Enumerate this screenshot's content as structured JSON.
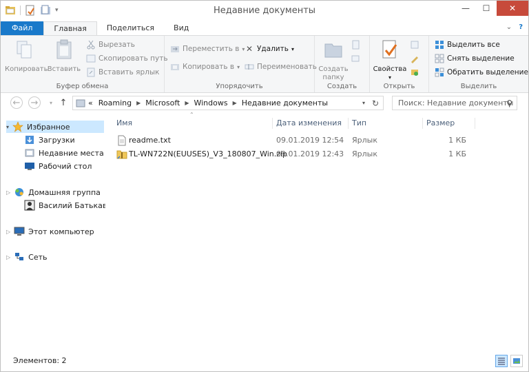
{
  "window": {
    "title": "Недавние документы"
  },
  "tabs": [
    {
      "label": "Файл"
    },
    {
      "label": "Главная"
    },
    {
      "label": "Поделиться"
    },
    {
      "label": "Вид"
    }
  ],
  "ribbon": {
    "clipboard": {
      "copy": "Копировать",
      "paste": "Вставить",
      "cut": "Вырезать",
      "copy_path": "Скопировать путь",
      "paste_shortcut": "Вставить ярлык",
      "label": "Буфер обмена"
    },
    "organize": {
      "move_to": "Переместить в",
      "copy_to": "Копировать в",
      "delete": "Удалить",
      "rename": "Переименовать",
      "label": "Упорядочить"
    },
    "create": {
      "new_folder_line1": "Создать",
      "new_folder_line2": "папку",
      "label": "Создать"
    },
    "open": {
      "properties": "Свойства",
      "label": "Открыть"
    },
    "select": {
      "select_all": "Выделить все",
      "select_none": "Снять выделение",
      "invert": "Обратить выделение",
      "label": "Выделить"
    }
  },
  "address": {
    "overflow": "«",
    "crumbs": [
      "Roaming",
      "Microsoft",
      "Windows",
      "Недавние документы"
    ]
  },
  "search": {
    "placeholder": "Поиск: Недавние документы"
  },
  "navpane": {
    "favorites": "Избранное",
    "downloads": "Загрузки",
    "recent": "Недавние места",
    "desktop": "Рабочий стол",
    "homegroup": "Домашняя группа",
    "user": "Василий Батькавыч",
    "computer": "Этот компьютер",
    "network": "Сеть"
  },
  "columns": {
    "name": "Имя",
    "date": "Дата изменения",
    "type": "Тип",
    "size": "Размер"
  },
  "files": [
    {
      "name": "readme.txt",
      "date": "09.01.2019 12:54",
      "type": "Ярлык",
      "size": "1 КБ",
      "icon": "text-file-icon"
    },
    {
      "name": "TL-WN722N(EUUSES)_V3_180807_Win.zip",
      "date": "09.01.2019 12:43",
      "type": "Ярлык",
      "size": "1 КБ",
      "icon": "zip-folder-icon"
    }
  ],
  "status": {
    "items": "Элементов: 2"
  },
  "colors": {
    "accent": "#1979ca",
    "close": "#c74a3b",
    "selection": "#cce8ff"
  }
}
